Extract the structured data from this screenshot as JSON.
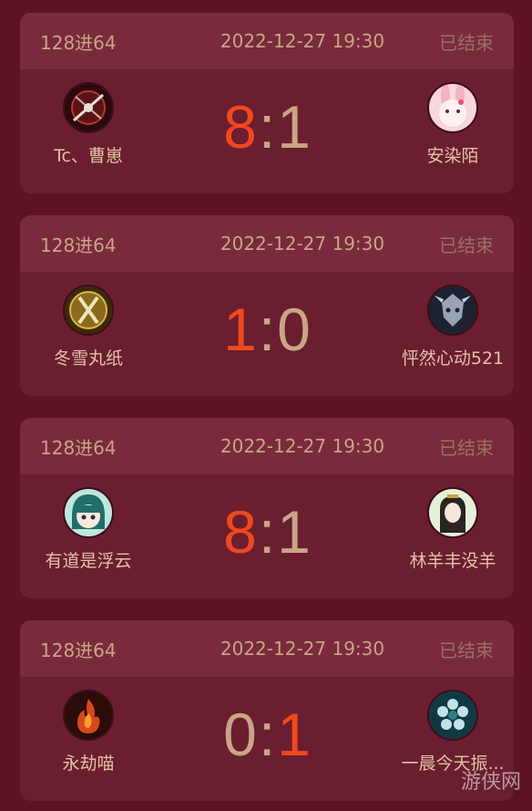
{
  "matches": [
    {
      "round": "128进64",
      "datetime": "2022-12-27 19:30",
      "status": "已结束",
      "left_player": {
        "name": "Tc、曹崽",
        "avatar_icon": "crossed-swords-avatar-icon"
      },
      "right_player": {
        "name": "安染陌",
        "avatar_icon": "pink-bunny-avatar-icon"
      },
      "left_score": "8",
      "right_score": "1",
      "winner": "left"
    },
    {
      "round": "128进64",
      "datetime": "2022-12-27 19:30",
      "status": "已结束",
      "left_player": {
        "name": "冬雪丸纸",
        "avatar_icon": "golden-emblem-avatar-icon"
      },
      "right_player": {
        "name": "怦然心动521",
        "avatar_icon": "dragon-mask-avatar-icon"
      },
      "left_score": "1",
      "right_score": "0",
      "winner": "left"
    },
    {
      "round": "128进64",
      "datetime": "2022-12-27 19:30",
      "status": "已结束",
      "left_player": {
        "name": "有道是浮云",
        "avatar_icon": "anime-girl-avatar-icon"
      },
      "right_player": {
        "name": "林羊丰没羊",
        "avatar_icon": "ancient-lady-avatar-icon"
      },
      "left_score": "8",
      "right_score": "1",
      "winner": "left"
    },
    {
      "round": "128进64",
      "datetime": "2022-12-27 19:30",
      "status": "已结束",
      "left_player": {
        "name": "永劫喵",
        "avatar_icon": "fire-avatar-icon"
      },
      "right_player": {
        "name": "一晨今天振...",
        "avatar_icon": "teal-flower-avatar-icon"
      },
      "left_score": "0",
      "right_score": "1",
      "winner": "right"
    }
  ],
  "watermark": "游侠网",
  "colors": {
    "background": "#5f1223",
    "card": "#6b1e30",
    "card_header": "#7a2a3c",
    "win_score": "#f0491c",
    "lose_score": "#c9a586",
    "status_text": "#9c6f64"
  }
}
